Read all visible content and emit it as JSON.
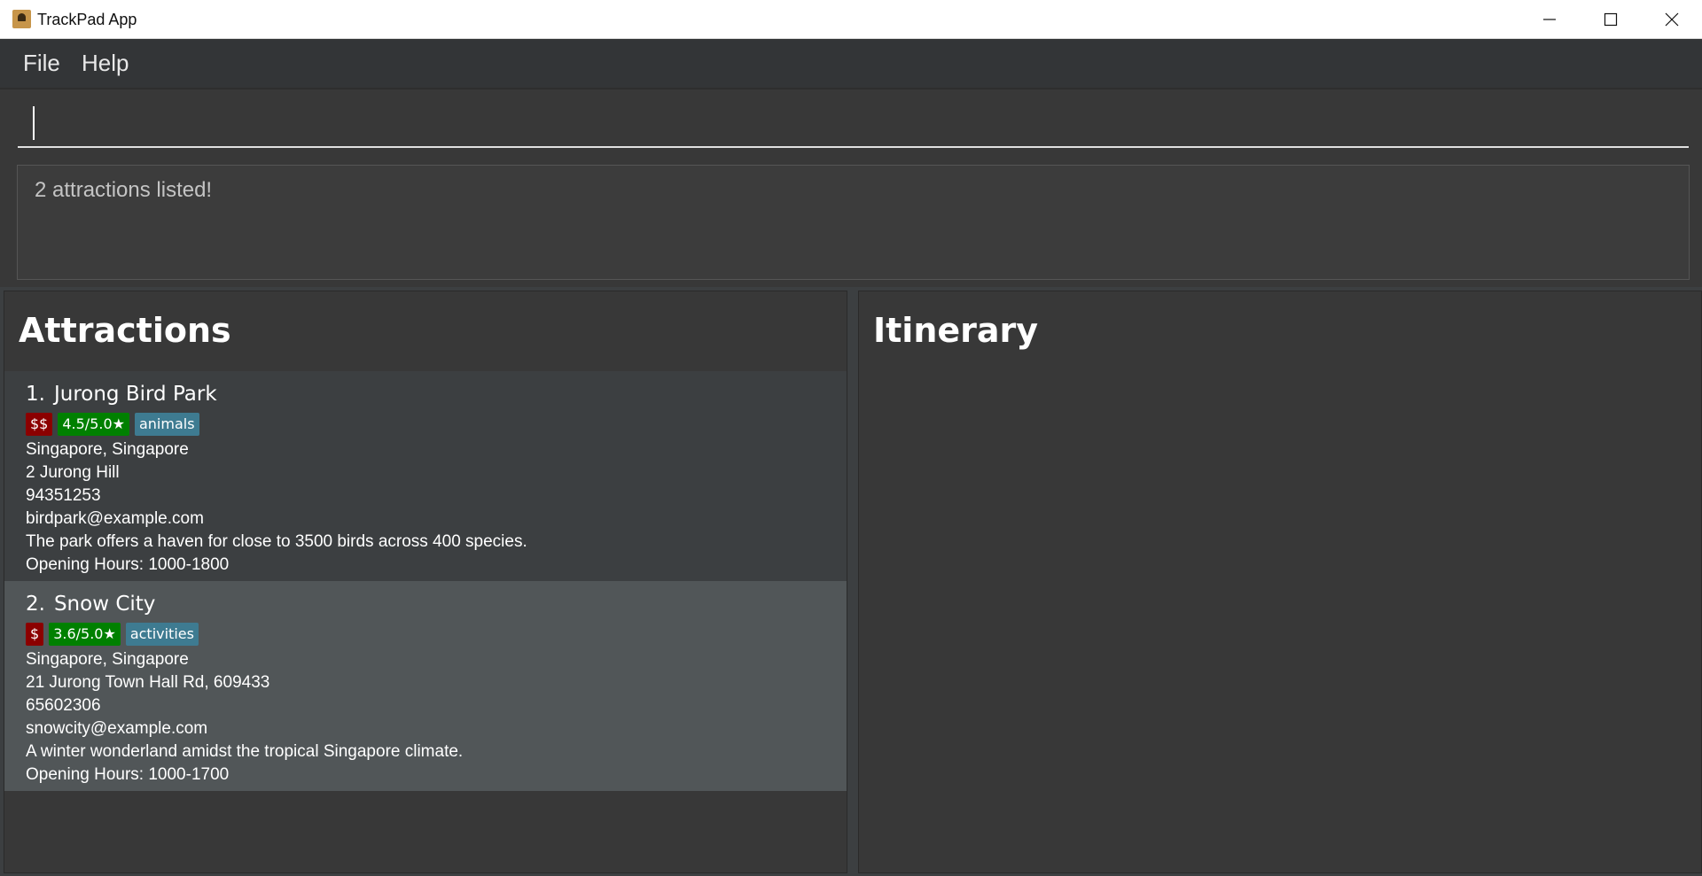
{
  "window": {
    "title": "TrackPad App",
    "controls": [
      "minimize",
      "maximize",
      "close"
    ]
  },
  "menu": {
    "items": [
      "File",
      "Help"
    ]
  },
  "command": {
    "value": ""
  },
  "result": {
    "message": "2 attractions listed!"
  },
  "attractions_panel": {
    "title": "Attractions",
    "items": [
      {
        "index": "1.",
        "name": "Jurong Bird Park",
        "price": "$$",
        "rating": "4.5/5.0★",
        "tag": "animals",
        "location": "Singapore, Singapore",
        "address": "2 Jurong Hill",
        "phone": "94351253",
        "email": "birdpark@example.com",
        "description": "The park offers a haven for close to 3500 birds across 400 species.",
        "hours": "Opening Hours: 1000-1800"
      },
      {
        "index": "2.",
        "name": "Snow City",
        "price": "$",
        "rating": "3.6/5.0★",
        "tag": "activities",
        "location": "Singapore, Singapore",
        "address": "21 Jurong Town Hall Rd, 609433",
        "phone": "65602306",
        "email": "snowcity@example.com",
        "description": "A winter wonderland amidst the tropical Singapore climate.",
        "hours": "Opening Hours: 1000-1700"
      }
    ]
  },
  "itinerary_panel": {
    "title": "Itinerary"
  },
  "colors": {
    "price_tag": "#8b0000",
    "rating_tag": "#008000",
    "category_tag": "#3e7b91",
    "selected_card": "#515658"
  }
}
